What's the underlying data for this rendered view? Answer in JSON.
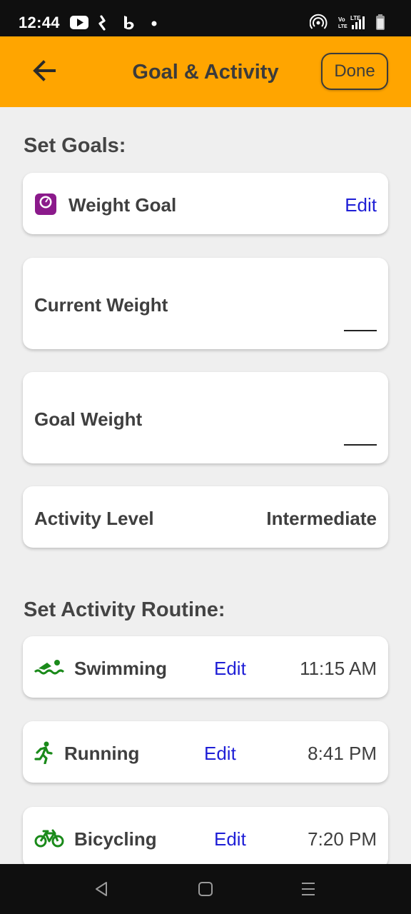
{
  "status_bar": {
    "time": "12:44",
    "left_icons": [
      "youtube-icon",
      "kite-icon",
      "bing-icon",
      "dot-icon"
    ],
    "right_icons": [
      "hotspot-icon",
      "volte-icon",
      "lte-signal-icon",
      "battery-icon"
    ],
    "volte_text": "Vo LTE",
    "lte_text": "LTE"
  },
  "header": {
    "title": "Goal & Activity",
    "done_label": "Done",
    "accent_color": "#ffa500"
  },
  "goals_section": {
    "title": "Set Goals:",
    "weight_goal": {
      "label": "Weight Goal",
      "edit_label": "Edit",
      "icon": "scale-icon",
      "icon_color": "#8b1a8b"
    },
    "current_weight": {
      "label": "Current Weight",
      "value": ""
    },
    "goal_weight": {
      "label": "Goal Weight",
      "value": ""
    },
    "activity_level": {
      "label": "Activity Level",
      "value": "Intermediate"
    }
  },
  "routine_section": {
    "title": "Set Activity Routine:",
    "activities": [
      {
        "name": "Swimming",
        "edit_label": "Edit",
        "time": "11:15 AM",
        "icon": "swimming-icon"
      },
      {
        "name": "Running",
        "edit_label": "Edit",
        "time": "8:41 PM",
        "icon": "running-icon"
      },
      {
        "name": "Bicycling",
        "edit_label": "Edit",
        "time": "7:20 PM",
        "icon": "bicycle-icon"
      }
    ],
    "icon_color": "#1a8a1a",
    "link_color": "#1f1fd6"
  },
  "nav_bar": {
    "buttons": [
      "back-triangle-icon",
      "home-square-icon",
      "menu-lines-icon"
    ]
  }
}
